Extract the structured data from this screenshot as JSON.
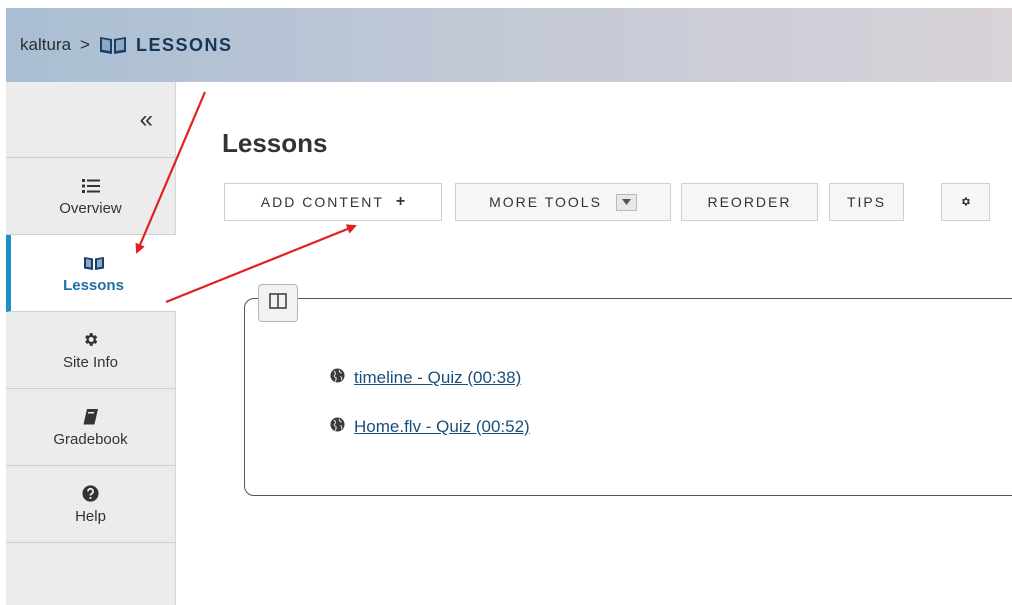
{
  "breadcrumb": {
    "site": "kaltura",
    "separator": ">",
    "tool": "LESSONS"
  },
  "sidebar": {
    "collapse_icon": "«",
    "items": [
      {
        "label": "Overview",
        "icon": "list-icon"
      },
      {
        "label": "Lessons",
        "icon": "book-open-icon",
        "active": true
      },
      {
        "label": "Site Info",
        "icon": "gear-icon"
      },
      {
        "label": "Gradebook",
        "icon": "book-icon"
      },
      {
        "label": "Help",
        "icon": "question-circle-icon"
      }
    ]
  },
  "main": {
    "title": "Lessons",
    "toolbar": {
      "add_content": "ADD CONTENT",
      "add_icon": "+",
      "more_tools": "MORE TOOLS",
      "reorder": "REORDER",
      "tips": "TIPS",
      "settings_icon": "gear-icon"
    },
    "items": [
      {
        "label": "timeline - Quiz (00:38)",
        "icon": "globe-icon"
      },
      {
        "label": "Home.flv - Quiz (00:52)",
        "icon": "globe-icon"
      }
    ]
  },
  "colors": {
    "accent": "#1d8fc7",
    "annotation_arrow": "#e02020",
    "link": "#1b4f7b"
  }
}
